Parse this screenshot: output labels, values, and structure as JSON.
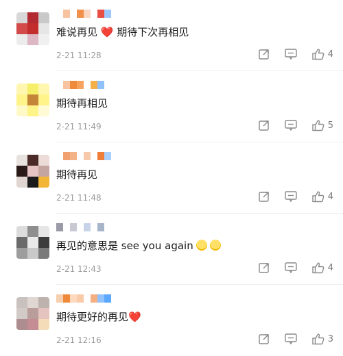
{
  "comments": [
    {
      "text_parts": [
        "难说再见 ",
        "❤️",
        " 期待下次再相见"
      ],
      "time": "2-21 11:28",
      "likes": "4",
      "avatar_colors": [
        "#d8d8d8",
        "#b22b33",
        "#c9c9c9",
        "#d24a4a",
        "#c32d2d",
        "#e6e6e6",
        "#ececec",
        "#ddb7c4",
        "#f0f0f0"
      ],
      "name_colors": [
        "#ffffff",
        "#f7c3a1",
        "#ffffff",
        "#f0904a",
        "#f9d7c2",
        "#ffffff",
        "#e84f42",
        "#9cc7ff"
      ]
    },
    {
      "text_parts": [
        "期待再相见",
        "",
        ""
      ],
      "time": "2-21 11:49",
      "likes": "5",
      "avatar_colors": [
        "#fff6b0",
        "#f6ef6a",
        "#fff6b0",
        "#fff48a",
        "#c58538",
        "#fff48a",
        "#fff9c8",
        "#fff48a",
        "#fffbd6"
      ],
      "name_colors": [
        "#ffffff",
        "#f7c3a1",
        "#ef8a3a",
        "#f7a35e",
        "#ffffff",
        "#f3b04a",
        "#8fc2ff",
        "#ffffff"
      ]
    },
    {
      "text_parts": [
        "期待再见",
        "",
        ""
      ],
      "time": "2-21 11:48",
      "likes": "4",
      "avatar_colors": [
        "#e8e2df",
        "#4b2b27",
        "#ecdcd8",
        "#2a1b18",
        "#e6c4c6",
        "#c5a5a0",
        "#e1d5d2",
        "#1a1a1a",
        "#f2b536"
      ],
      "name_colors": [
        "#ffffff",
        "#f1a070",
        "#f4b288",
        "#ffffff",
        "#f6c9aa",
        "#ffffff",
        "#ef7d3a",
        "#a9cffb"
      ]
    },
    {
      "text_parts": [
        "再见的意思是 see you again",
        "",
        ""
      ],
      "time": "2-21 12:43",
      "likes": "4",
      "avatar_colors": [
        "#dcdcdc",
        "#8e8e8e",
        "#e6e6e6",
        "#6a6a6a",
        "#e9e9e9",
        "#3c3c3c",
        "#9d9d9d",
        "#c8c8c8",
        "#7a7a7a"
      ],
      "name_colors": [
        "#9a9aa8",
        "#ffffff",
        "#c9c9d4",
        "#ffffff",
        "#c7d3e6",
        "#ffffff",
        "#a7b5cb",
        "#ffffff"
      ]
    },
    {
      "text_parts": [
        "期待更好的再见",
        "❤️",
        ""
      ],
      "time": "2-21 12:16",
      "likes": "3",
      "avatar_colors": [
        "#c9c1bd",
        "#e0d7d2",
        "#bdb2ad",
        "#d2cac6",
        "#b99d9a",
        "#e5c4c0",
        "#ae8d8f",
        "#c48c93",
        "#f4dcb8"
      ],
      "name_colors": [
        "#f5cfae",
        "#ef8a3a",
        "#ffd9bd",
        "#f9cba8",
        "#ffffff",
        "#f4b080",
        "#8fc2ff",
        "#5aa8ff"
      ]
    }
  ],
  "icons": {
    "share": "share-icon",
    "comment": "comment-icon",
    "like": "thumbs-up-icon"
  },
  "emoji_count_row4": 2
}
